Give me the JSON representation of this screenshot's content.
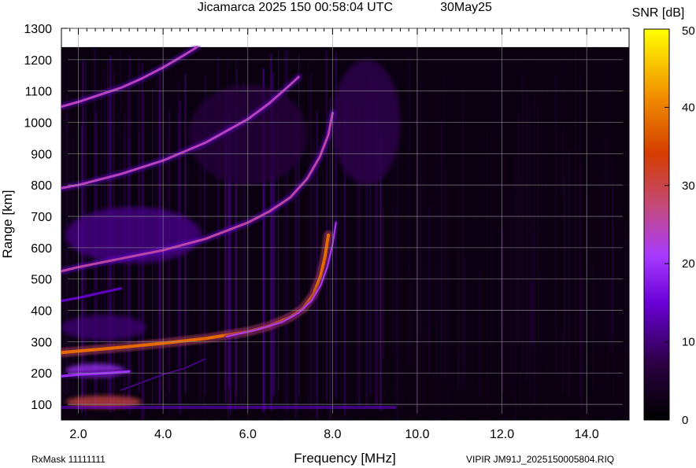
{
  "header": {
    "title": "Jicamarca 2025 150 00:58:04 UTC",
    "date": "30May25"
  },
  "footer": {
    "rxmask": "RxMask 11111111",
    "filename": "VIPIR  JM91J_2025150005804.RIQ"
  },
  "chart_data": {
    "type": "heatmap",
    "title": "Jicamarca 2025 150 00:58:04 UTC",
    "xlabel": "Frequency [MHz]",
    "ylabel": "Range [km]",
    "xlim": [
      1.6,
      15.0
    ],
    "ylim": [
      50,
      1300
    ],
    "x_ticks": [
      2.0,
      4.0,
      6.0,
      8.0,
      10.0,
      12.0,
      14.0
    ],
    "x_tick_labels": [
      "2.0",
      "4.0",
      "6.0",
      "8.0",
      "10.0",
      "12.0",
      "14.0"
    ],
    "y_ticks": [
      100,
      200,
      300,
      400,
      500,
      600,
      700,
      800,
      900,
      1000,
      1100,
      1200,
      1300
    ],
    "y_tick_labels": [
      "100",
      "200",
      "300",
      "400",
      "500",
      "600",
      "700",
      "800",
      "900",
      "1000",
      "1100",
      "1200",
      "1300"
    ],
    "data_range_y_max": 1240,
    "grid": true,
    "colorbar": {
      "label": "SNR [dB]",
      "range": [
        0,
        50
      ],
      "ticks": [
        0,
        10,
        20,
        30,
        40,
        50
      ],
      "tick_labels": [
        "0",
        "10",
        "20",
        "30",
        "40",
        "50"
      ],
      "colors": [
        "#000000",
        "#3a0068",
        "#8a00ff",
        "#c64a8a",
        "#d63a00",
        "#f08c00",
        "#ffff00"
      ]
    },
    "traces": [
      {
        "name": "",
        "points": [
          [
            1.6,
            265
          ],
          [
            2.0,
            270
          ],
          [
            3.0,
            282
          ],
          [
            4.0,
            295
          ],
          [
            5.0,
            310
          ],
          [
            6.0,
            332
          ],
          [
            6.5,
            350
          ],
          [
            7.0,
            378
          ],
          [
            7.3,
            405
          ],
          [
            7.55,
            450
          ],
          [
            7.72,
            510
          ],
          [
            7.82,
            570
          ],
          [
            7.9,
            640
          ]
        ],
        "snr": 38,
        "width": 4.0
      },
      {
        "name": "",
        "points": [
          [
            5.5,
            316
          ],
          [
            6.2,
            338
          ],
          [
            6.8,
            362
          ],
          [
            7.2,
            392
          ],
          [
            7.5,
            430
          ],
          [
            7.72,
            480
          ],
          [
            7.88,
            540
          ],
          [
            8.0,
            610
          ],
          [
            8.08,
            680
          ]
        ],
        "snr": 22,
        "width": 2.0
      },
      {
        "name": "",
        "points": [
          [
            1.6,
            525
          ],
          [
            2.0,
            538
          ],
          [
            3.0,
            565
          ],
          [
            4.0,
            592
          ],
          [
            5.0,
            628
          ],
          [
            6.0,
            680
          ],
          [
            6.5,
            715
          ],
          [
            7.0,
            760
          ],
          [
            7.4,
            820
          ],
          [
            7.7,
            890
          ],
          [
            7.9,
            960
          ],
          [
            8.0,
            1030
          ]
        ],
        "snr": 25,
        "width": 3.0
      },
      {
        "name": "",
        "points": [
          [
            1.6,
            790
          ],
          [
            2.0,
            800
          ],
          [
            3.0,
            835
          ],
          [
            4.0,
            878
          ],
          [
            5.0,
            935
          ],
          [
            6.0,
            1010
          ],
          [
            6.5,
            1060
          ],
          [
            7.0,
            1120
          ],
          [
            7.2,
            1145
          ]
        ],
        "snr": 24,
        "width": 3.0
      },
      {
        "name": "",
        "points": [
          [
            1.6,
            1050
          ],
          [
            2.0,
            1065
          ],
          [
            3.0,
            1110
          ],
          [
            3.5,
            1140
          ],
          [
            4.0,
            1175
          ],
          [
            4.5,
            1215
          ],
          [
            4.8,
            1240
          ]
        ],
        "snr": 24,
        "width": 3.0
      },
      {
        "name": "",
        "points": [
          [
            1.6,
            430
          ],
          [
            2.0,
            440
          ],
          [
            2.5,
            455
          ],
          [
            3.0,
            470
          ]
        ],
        "snr": 14,
        "width": 3.0
      },
      {
        "name": "",
        "points": [
          [
            1.6,
            190
          ],
          [
            2.0,
            195
          ],
          [
            2.7,
            200
          ],
          [
            3.2,
            205
          ]
        ],
        "snr": 20,
        "width": 3.0
      },
      {
        "name": "",
        "points": [
          [
            3.0,
            145
          ],
          [
            3.5,
            170
          ],
          [
            4.0,
            195
          ],
          [
            4.5,
            215
          ],
          [
            5.0,
            245
          ]
        ],
        "snr": 12,
        "width": 1.5
      }
    ],
    "blobs": [
      {
        "x": 2.6,
        "y": 108,
        "rx": 0.9,
        "ry": 20,
        "snr": 30
      },
      {
        "x": 2.4,
        "y": 208,
        "rx": 0.7,
        "ry": 22,
        "snr": 20
      },
      {
        "x": 3.3,
        "y": 640,
        "rx": 1.6,
        "ry": 90,
        "snr": 11
      },
      {
        "x": 2.6,
        "y": 345,
        "rx": 1.0,
        "ry": 40,
        "snr": 10
      },
      {
        "x": 8.8,
        "y": 1000,
        "rx": 0.8,
        "ry": 200,
        "snr": 8
      },
      {
        "x": 6.0,
        "y": 960,
        "rx": 1.4,
        "ry": 160,
        "snr": 7
      }
    ],
    "baseline_echo": {
      "y": 90,
      "snr": 14
    }
  }
}
